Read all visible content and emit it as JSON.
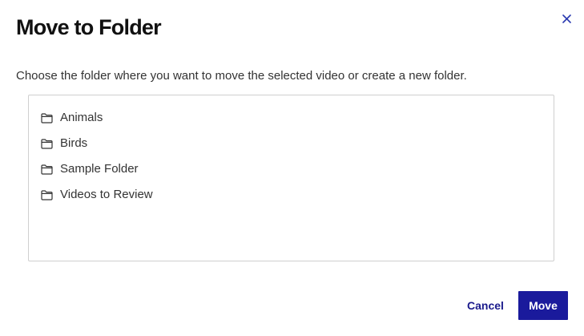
{
  "dialog": {
    "title": "Move to Folder",
    "description": "Choose the folder where you want to move the selected video or create a new folder.",
    "close_icon": "close-icon",
    "folders": [
      {
        "label": "Animals",
        "icon": "folder-icon"
      },
      {
        "label": "Birds",
        "icon": "folder-icon"
      },
      {
        "label": "Sample Folder",
        "icon": "folder-icon"
      },
      {
        "label": "Videos to Review",
        "icon": "folder-icon"
      }
    ],
    "cancel_label": "Cancel",
    "move_label": "Move"
  },
  "colors": {
    "accent": "#1a1a9c",
    "close_icon": "#2a3ab0",
    "border": "#cfcfcf"
  }
}
